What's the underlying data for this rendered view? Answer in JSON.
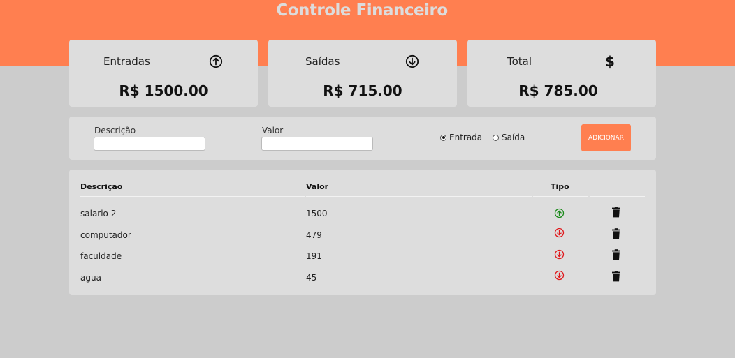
{
  "header": {
    "title": "Controle Financeiro",
    "accent_color": "#ff7f50"
  },
  "summary": {
    "income": {
      "label": "Entradas",
      "icon": "arrow-up-circle-icon",
      "value": "R$ 1500.00"
    },
    "expenses": {
      "label": "Saídas",
      "icon": "arrow-down-circle-icon",
      "value": "R$ 715.00"
    },
    "total": {
      "label": "Total",
      "icon": "dollar-icon",
      "value": "R$ 785.00"
    }
  },
  "form": {
    "description_label": "Descrição",
    "description_value": "",
    "amount_label": "Valor",
    "amount_value": "",
    "type_options": [
      {
        "label": "Entrada",
        "checked": true
      },
      {
        "label": "Saída",
        "checked": false
      }
    ],
    "add_button_label": "ADICIONAR"
  },
  "table": {
    "columns": [
      "Descrição",
      "Valor",
      "Tipo"
    ],
    "rows": [
      {
        "description": "salario 2",
        "amount": "1500",
        "type": "income",
        "type_icon": "arrow-up-circle-icon",
        "type_color": "#1a8a1a",
        "action_icon": "trash-icon"
      },
      {
        "description": "computador",
        "amount": "479",
        "type": "expense",
        "type_icon": "arrow-down-circle-icon",
        "type_color": "#e0191c",
        "action_icon": "trash-icon"
      },
      {
        "description": "faculdade",
        "amount": "191",
        "type": "expense",
        "type_icon": "arrow-down-circle-icon",
        "type_color": "#e0191c",
        "action_icon": "trash-icon"
      },
      {
        "description": "agua",
        "amount": "45",
        "type": "expense",
        "type_icon": "arrow-down-circle-icon",
        "type_color": "#e0191c",
        "action_icon": "trash-icon"
      }
    ]
  }
}
